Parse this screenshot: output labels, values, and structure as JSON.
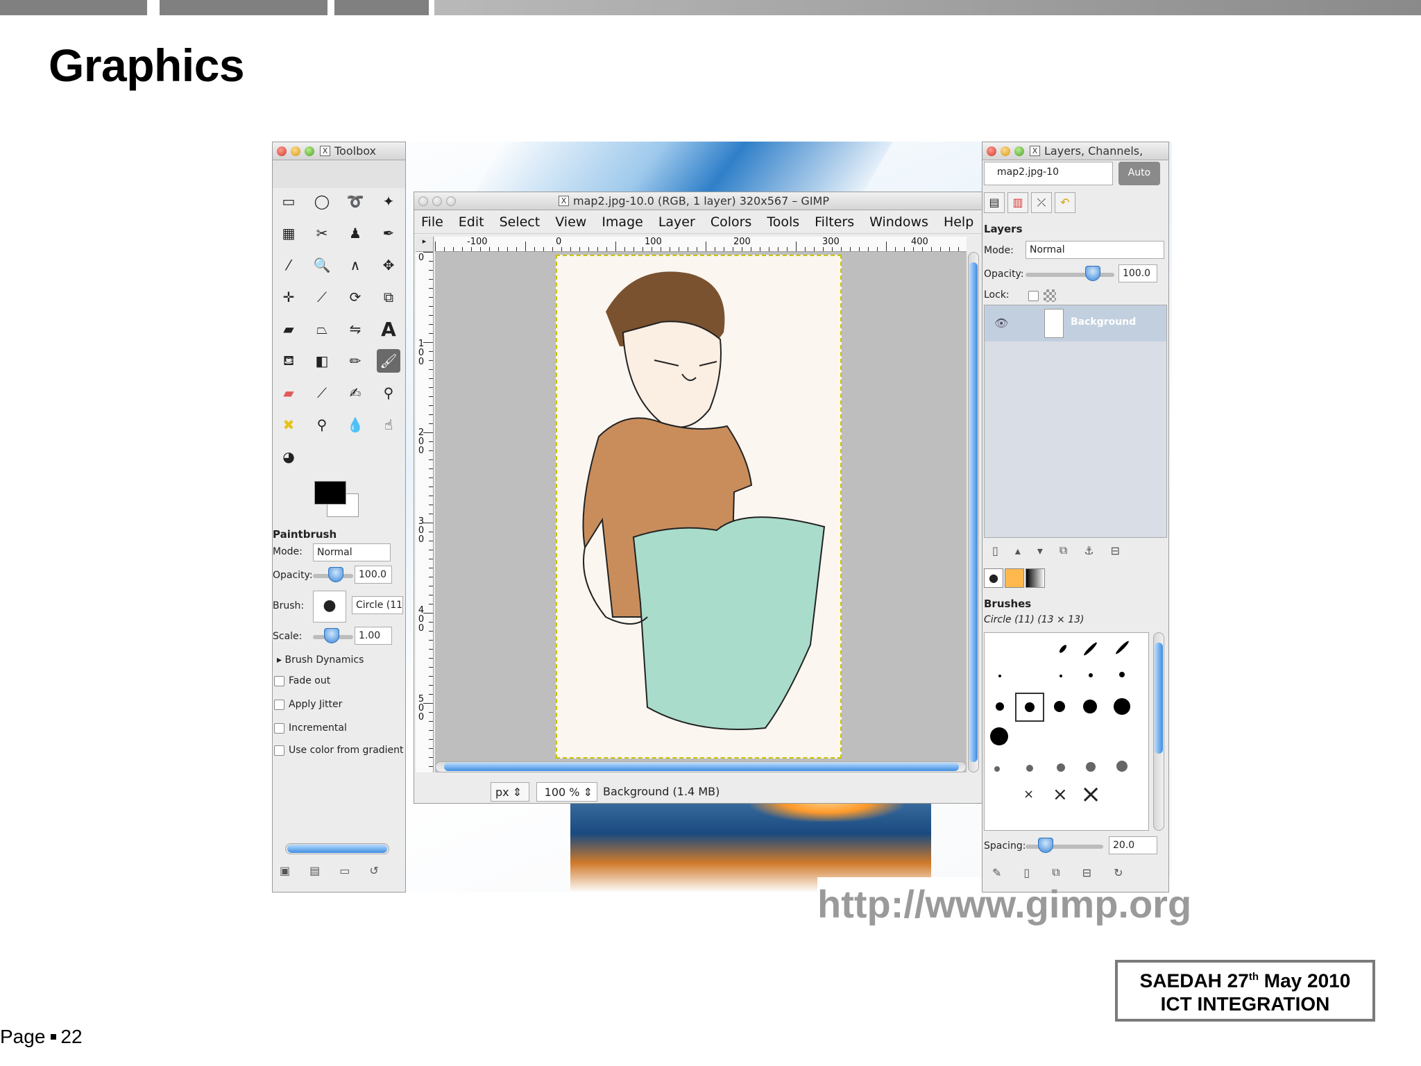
{
  "slide": {
    "title": "Graphics",
    "url": "http://www.gimp.org",
    "event_line1_prefix": "SAEDAH 27",
    "event_line1_sup": "th",
    "event_line1_suffix": " May 2010",
    "event_line2": "ICT INTEGRATION",
    "page_label": "Page",
    "page_number": "22"
  },
  "toolbox": {
    "title": "Toolbox",
    "tool_options_title": "Paintbrush",
    "mode_label": "Mode:",
    "mode_value": "Normal",
    "opacity_label": "Opacity:",
    "opacity_value": "100.0",
    "brush_label": "Brush:",
    "brush_value": "Circle (11",
    "scale_label": "Scale:",
    "scale_value": "1.00",
    "brush_dynamics": "Brush Dynamics",
    "options": [
      "Fade out",
      "Apply Jitter",
      "Incremental",
      "Use color from gradient"
    ],
    "tools": [
      "rect-select",
      "ellipse-select",
      "free-select",
      "fuzzy-select",
      "color-select",
      "scissors",
      "foreground-select",
      "paths",
      "color-picker",
      "zoom",
      "measure",
      "move",
      "align",
      "crop",
      "rotate",
      "scale",
      "shear",
      "perspective",
      "flip",
      "text",
      "bucket-fill",
      "blend",
      "pencil",
      "paintbrush",
      "eraser",
      "airbrush",
      "ink",
      "clone",
      "heal",
      "perspective-clone",
      "blur",
      "smudge",
      "dodge-burn"
    ],
    "active_tool": "paintbrush",
    "foreground_color": "#000000",
    "background_color": "#ffffff"
  },
  "image_window": {
    "title": "map2.jpg-10.0 (RGB, 1 layer) 320x567 – GIMP",
    "menu": [
      {
        "label": "File"
      },
      {
        "label": "Edit"
      },
      {
        "label": "Select"
      },
      {
        "label": "View"
      },
      {
        "label": "Image"
      },
      {
        "label": "Layer"
      },
      {
        "label": "Colors"
      },
      {
        "label": "Tools"
      },
      {
        "label": "Filters"
      },
      {
        "label": "Windows"
      },
      {
        "label": "Help"
      }
    ],
    "ruler_h_labels": [
      "-100",
      "0",
      "100",
      "200",
      "300",
      "400"
    ],
    "ruler_v_labels": [
      "0",
      "100",
      "200",
      "300",
      "400",
      "500"
    ],
    "unit": "px",
    "zoom": "100 %",
    "status": "Background (1.4 MB)"
  },
  "dock": {
    "title": "Layers, Channels,",
    "image_selector": "map2.jpg-10",
    "auto_button": "Auto",
    "layers_title": "Layers",
    "mode_label": "Mode:",
    "mode_value": "Normal",
    "opacity_label": "Opacity:",
    "opacity_value": "100.0",
    "lock_label": "Lock:",
    "layer_name": "Background",
    "brushes_title": "Brushes",
    "brush_selected": "Circle (11) (13 × 13)",
    "spacing_label": "Spacing:",
    "spacing_value": "20.0"
  },
  "colors": {
    "accent_blue": "#3e8de0",
    "canvas_bg": "#bebebe",
    "layer_highlight": "#c2cfdf"
  }
}
